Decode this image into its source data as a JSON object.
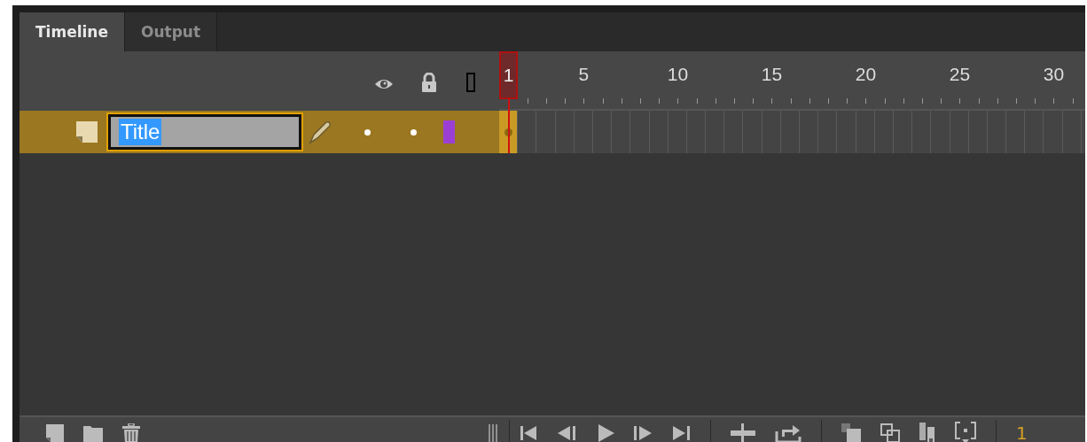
{
  "tabs": [
    {
      "label": "Timeline",
      "selected": true
    },
    {
      "label": "Output",
      "selected": false
    }
  ],
  "ruler": {
    "labels": [
      "5",
      "10",
      "15",
      "20",
      "25",
      "30"
    ],
    "current_frame": "1"
  },
  "layers": [
    {
      "name": "Title",
      "selected": true,
      "editing": true,
      "visible": true,
      "unlocked": true,
      "color": "#9b3fd4"
    }
  ],
  "frame_counter": "1"
}
